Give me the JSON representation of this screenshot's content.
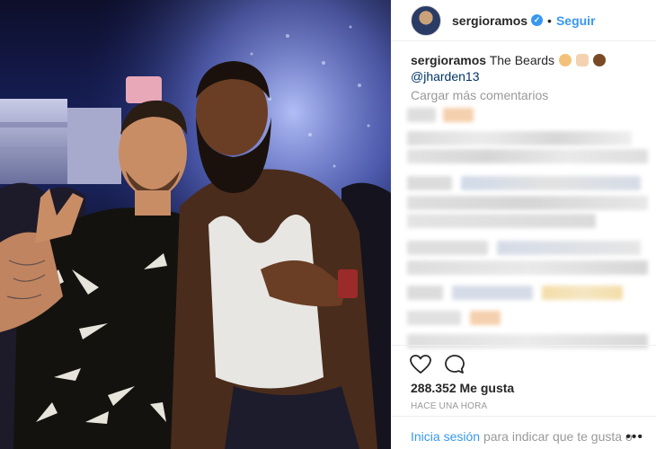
{
  "post": {
    "username": "sergioramos",
    "follow_label": "Seguir",
    "dot": "•",
    "caption_text": "The Beards",
    "mention": "@jharden13",
    "load_more": "Cargar más comentarios",
    "likes": "288.352 Me gusta",
    "timestamp": "HACE UNA HORA",
    "login_link": "Inicia sesión",
    "login_rest": "para indicar que te gusta o",
    "more_options": "•••"
  },
  "icons": {
    "verified": "verified-badge-icon",
    "like": "heart-icon",
    "comment": "comment-bubble-icon",
    "emojis": [
      "bearded-face-emoji",
      "victory-hand-emoji",
      "dark-bearded-face-emoji"
    ]
  },
  "colors": {
    "link_blue": "#3897f0",
    "mention_blue": "#003569",
    "muted_gray": "#999999",
    "divider": "#efefef",
    "text": "#262626"
  }
}
